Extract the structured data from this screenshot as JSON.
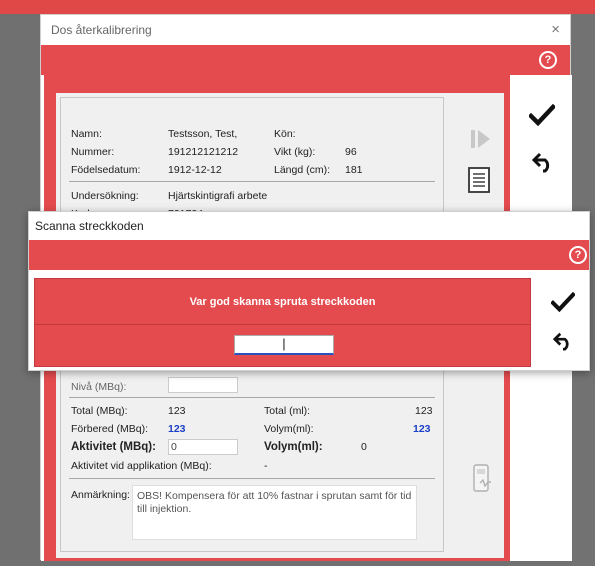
{
  "main_dialog": {
    "title": "Dos återkalibrering",
    "close_glyph": "×",
    "help_glyph": "?",
    "patient": {
      "name_label": "Namn:",
      "name_value": "Testsson, Test,",
      "gender_label": "Kön:",
      "gender_value": "",
      "number_label": "Nummer:",
      "number_value": "191212121212",
      "weight_label": "Vikt (kg):",
      "weight_value": "96",
      "birth_label": "Födelsedatum:",
      "birth_value": "1912-12-12",
      "height_label": "Längd (cm):",
      "height_value": "181"
    },
    "exam": {
      "exam_label": "Undersökning:",
      "exam_value": "Hjärtskintigrafi arbete",
      "code_label": "Kod:",
      "code_value": "721724"
    },
    "partial_row_label": "Nivå (MBq):",
    "totals": {
      "total_mbq_label": "Total (MBq):",
      "total_mbq_value": "123",
      "total_ml_label": "Total (ml):",
      "total_ml_value": "123",
      "prepared_label": "Förbered (MBq):",
      "prepared_value": "123",
      "volume_ml_label": "Volym(ml):",
      "volume_ml_value": "123",
      "activity_label": "Aktivitet (MBq):",
      "activity_value": "0",
      "volume_label": "Volym(ml):",
      "volume_value": "0",
      "activity_app_label": "Aktivitet vid applikation (MBq):",
      "activity_app_value": "-"
    },
    "note": {
      "label": "Anmärkning:",
      "text": "OBS! Kompensera för att 10% fastnar i sprutan samt för tid till injektion."
    }
  },
  "scan_dialog": {
    "title": "Scanna streckkoden",
    "help_glyph": "?",
    "message": "Var god skanna spruta streckkoden",
    "input_value": "|"
  },
  "icons": {
    "play": "play-step-icon",
    "report": "report-icon",
    "confirm": "check-icon",
    "undo": "undo-icon",
    "device": "syringe-device-icon"
  },
  "colors": {
    "accent_red": "#e34b4f",
    "value_blue": "#1a3fc6"
  }
}
